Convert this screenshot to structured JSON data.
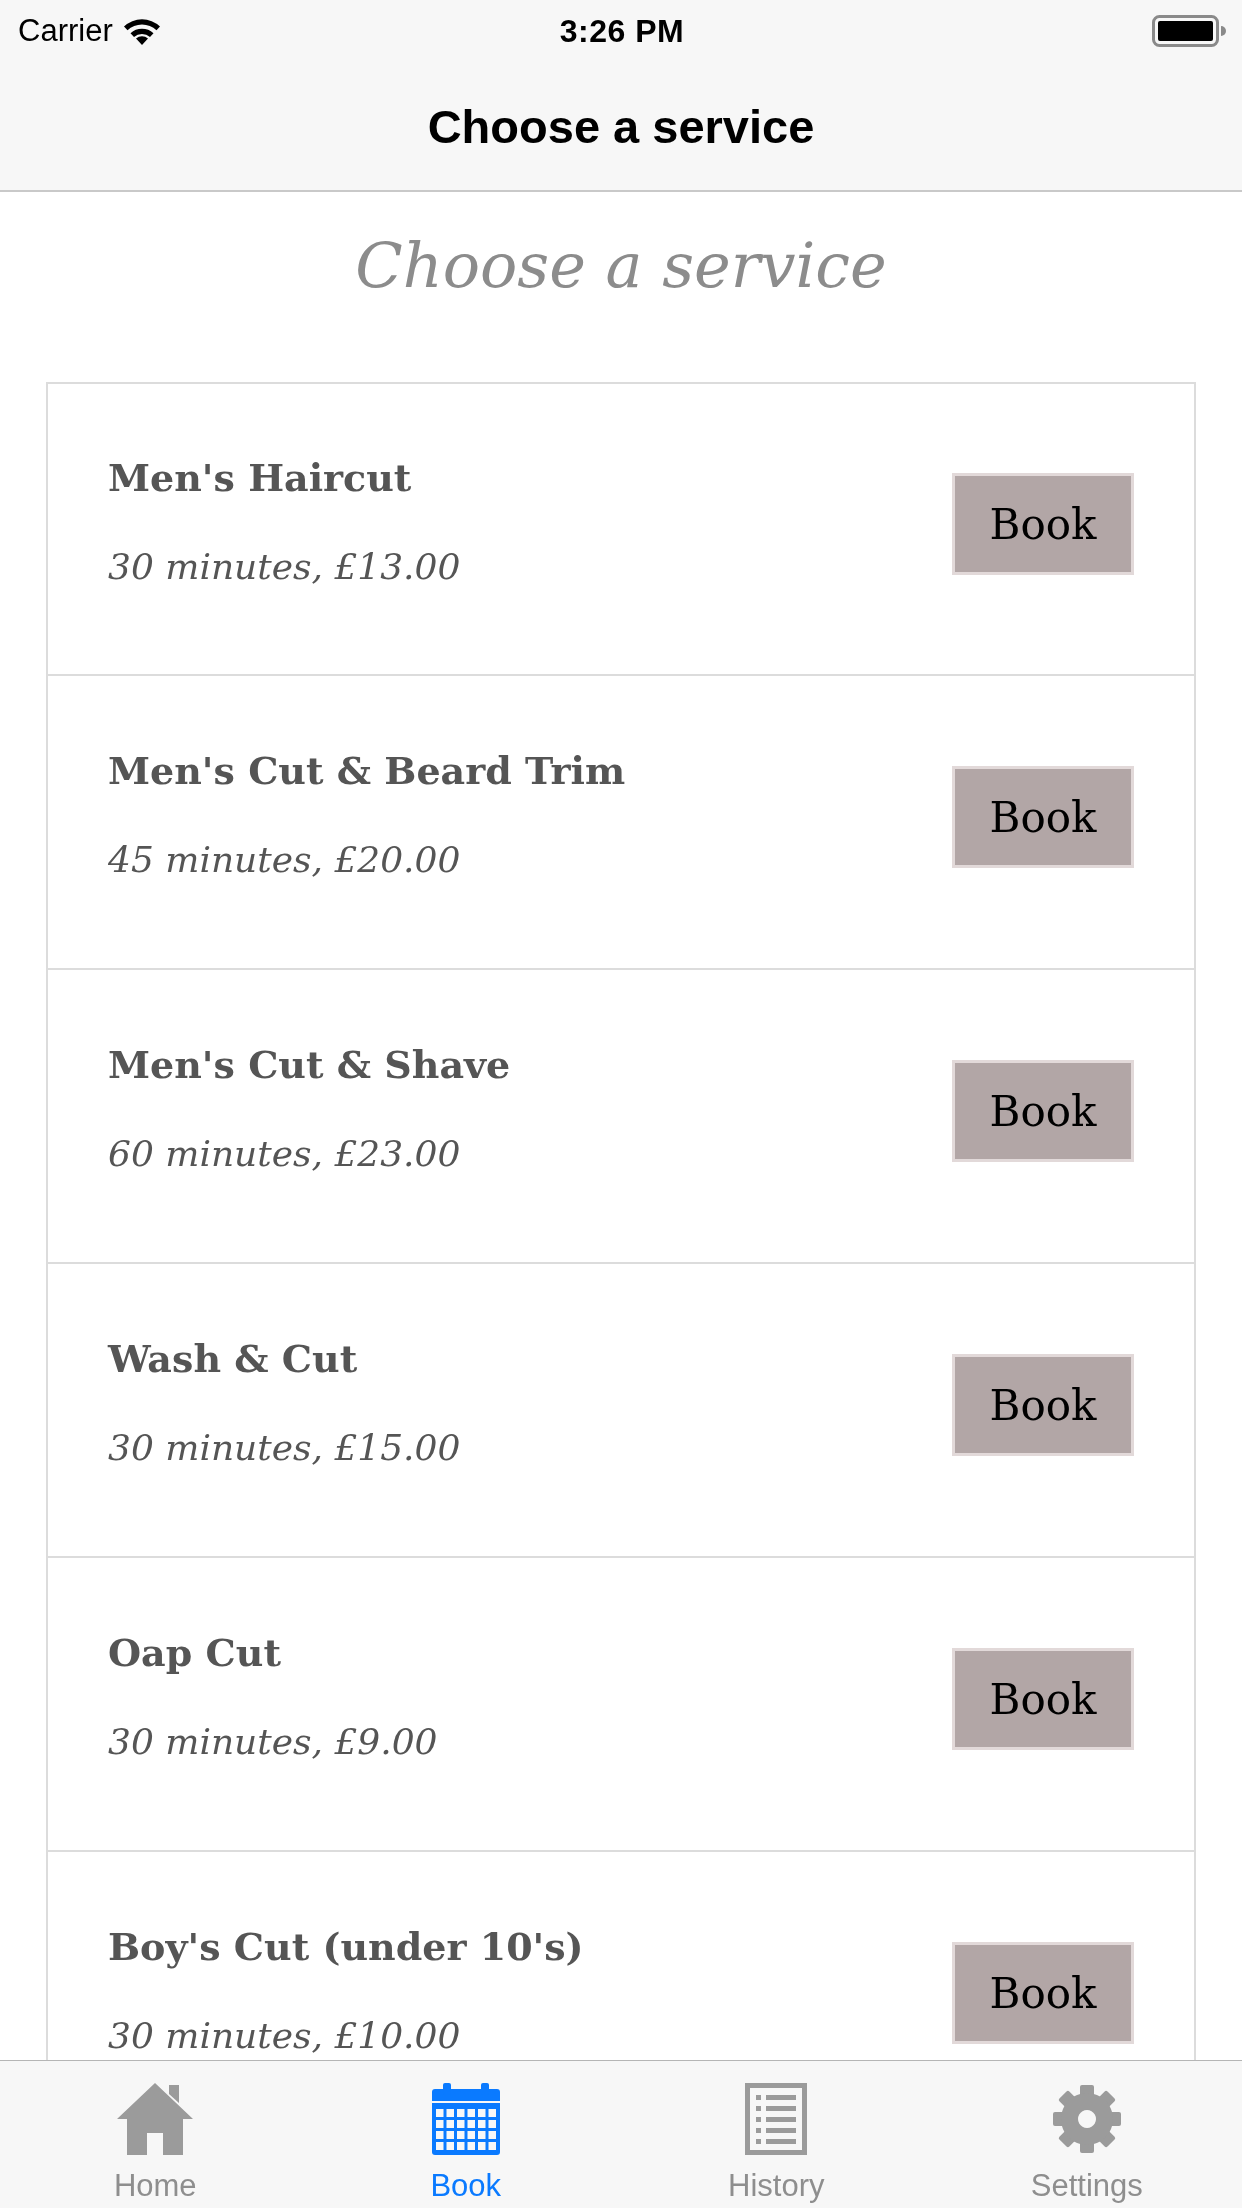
{
  "status_bar": {
    "carrier": "Carrier",
    "time": "3:26 PM"
  },
  "nav_bar": {
    "title": "Choose a service"
  },
  "heading": "Choose a service",
  "services": [
    {
      "name": "Men's Haircut",
      "details": "30 minutes, £13.00",
      "button": "Book"
    },
    {
      "name": "Men's Cut & Beard Trim",
      "details": "45 minutes, £20.00",
      "button": "Book"
    },
    {
      "name": "Men's Cut & Shave",
      "details": "60 minutes, £23.00",
      "button": "Book"
    },
    {
      "name": "Wash & Cut",
      "details": "30 minutes, £15.00",
      "button": "Book"
    },
    {
      "name": "Oap Cut",
      "details": "30 minutes, £9.00",
      "button": "Book"
    },
    {
      "name": "Boy's Cut (under 10's)",
      "details": "30 minutes, £10.00",
      "button": "Book"
    }
  ],
  "tab_bar": {
    "tabs": [
      {
        "label": "Home",
        "kind": "home",
        "selected": false
      },
      {
        "label": "Book",
        "kind": "calendar",
        "selected": true
      },
      {
        "label": "History",
        "kind": "list",
        "selected": false
      },
      {
        "label": "Settings",
        "kind": "gear",
        "selected": false
      }
    ]
  }
}
